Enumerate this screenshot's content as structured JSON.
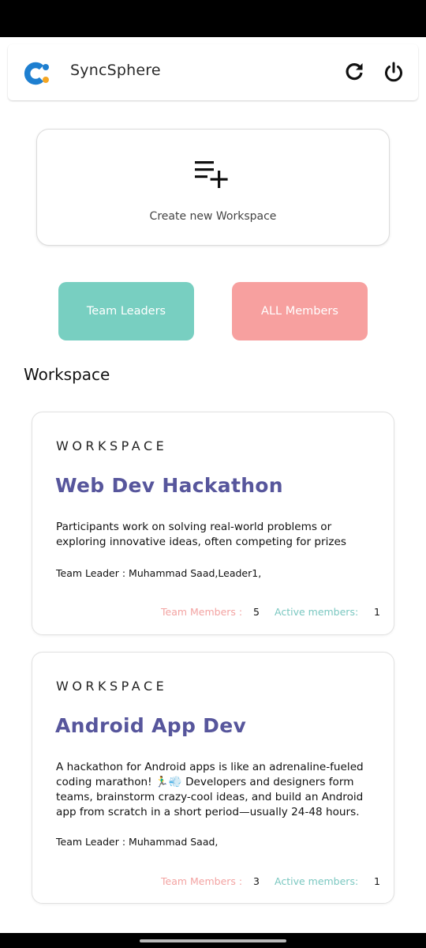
{
  "app": {
    "title": "SyncSphere"
  },
  "header": {
    "refresh_icon": "refresh-icon",
    "power_icon": "power-icon"
  },
  "create_workspace": {
    "label": "Create new Workspace",
    "icon": "playlist-add-icon"
  },
  "filters": {
    "team_leaders_label": "Team Leaders",
    "all_members_label": "ALL Members"
  },
  "section": {
    "title": "Workspace"
  },
  "colors": {
    "brand_blue": "#1e7fd0",
    "brand_orange": "#f5a623",
    "team_leaders_bg": "#78cfc1",
    "all_members_bg": "#f7a09f",
    "workspace_title": "#57569c"
  },
  "workspaces": [
    {
      "label": "WORKSPACE",
      "name": "Web Dev Hackathon",
      "description": "Participants work on solving real-world problems or exploring innovative ideas, often competing for prizes",
      "leader": "Team Leader : Muhammad Saad,Leader1,",
      "members_label": "Team Members :",
      "members_count": "5",
      "active_label": "Active members:",
      "active_count": "1"
    },
    {
      "label": "WORKSPACE",
      "name": "Android App Dev",
      "description": "A hackathon for Android apps is like an adrenaline-fueled coding marathon! 🏃‍♂️💨 Developers and designers form teams, brainstorm crazy-cool ideas, and build an Android app from scratch in a short period—usually 24-48 hours.",
      "leader": "Team Leader : Muhammad Saad,",
      "members_label": "Team Members :",
      "members_count": "3",
      "active_label": "Active members:",
      "active_count": "1"
    }
  ]
}
